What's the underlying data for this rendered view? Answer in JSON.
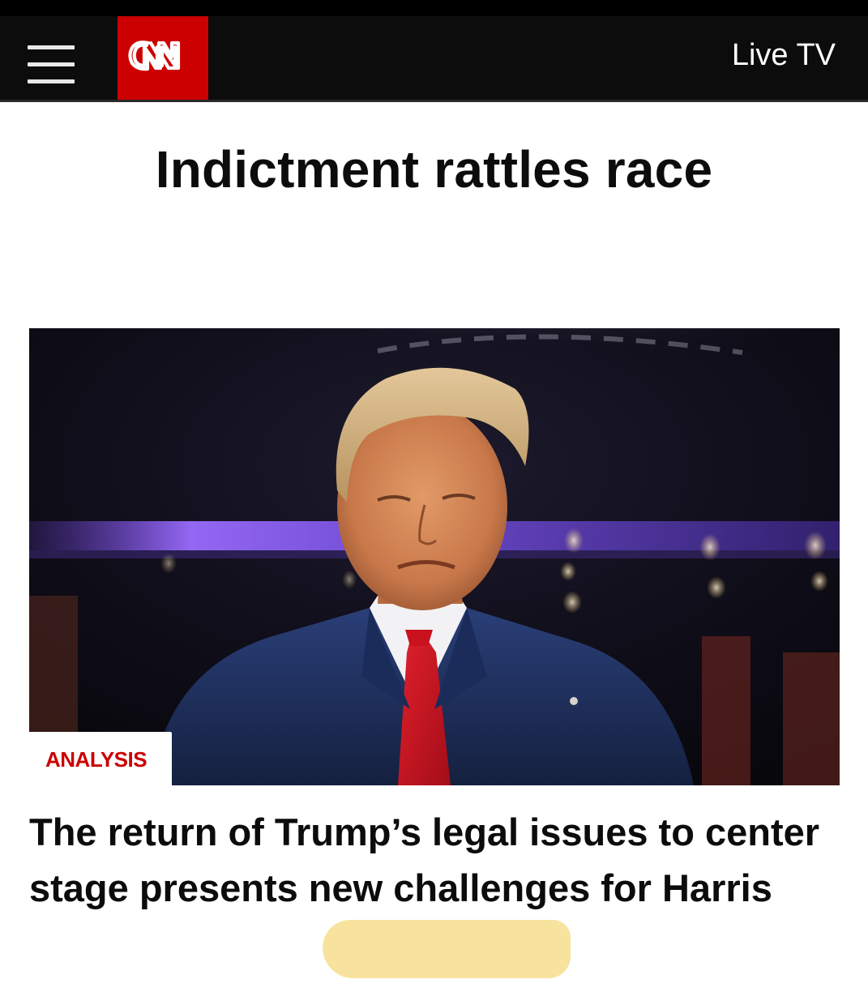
{
  "header": {
    "menu_icon": "hamburger-menu-icon",
    "logo_text": "CNN",
    "live_tv_label": "Live TV",
    "brand_color": "#cc0000"
  },
  "headline": "Indictment rattles race",
  "hero": {
    "label": "ANALYSIS"
  },
  "story": {
    "title": "The return of Trump’s legal issues to center stage presents new challenges for Harris",
    "highlight_color": "#f5d879"
  }
}
